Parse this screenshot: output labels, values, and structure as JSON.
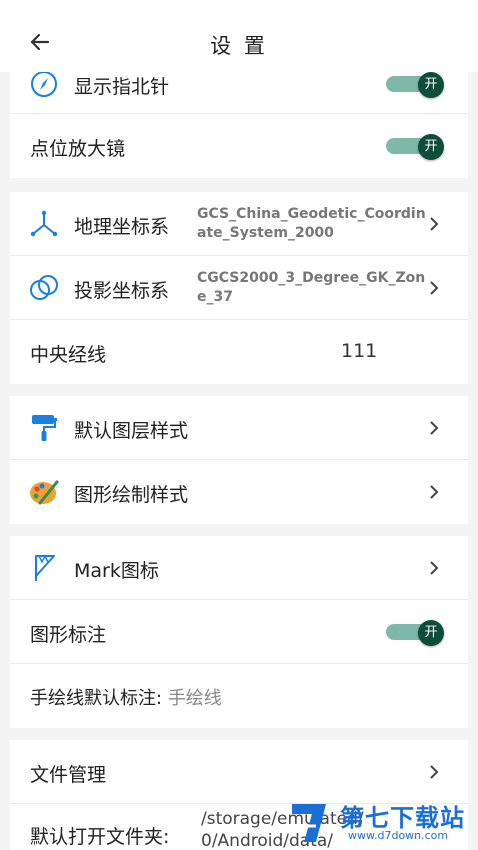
{
  "header": {
    "title": "设 置"
  },
  "rows": {
    "compass": {
      "label": "显示指北针",
      "toggle": "开"
    },
    "magnifier": {
      "label": "点位放大镜",
      "toggle": "开"
    },
    "geo_crs": {
      "label": "地理坐标系",
      "value": "GCS_China_Geodetic_Coordinate_System_2000"
    },
    "proj_crs": {
      "label": "投影坐标系",
      "value": "CGCS2000_3_Degree_GK_Zone_37"
    },
    "meridian": {
      "label": "中央经线",
      "value": "111"
    },
    "layer_style": {
      "label": "默认图层样式"
    },
    "draw_style": {
      "label": "图形绘制样式"
    },
    "mark_icon": {
      "label": "Mark图标"
    },
    "shape_label": {
      "label": "图形标注",
      "toggle": "开"
    },
    "freehand_label": {
      "label": "手绘线默认标注:",
      "value": "手绘线"
    },
    "file_mgmt": {
      "label": "文件管理"
    },
    "default_folder": {
      "label": "默认打开文件夹:",
      "value_line1": "/storage/emulated/",
      "value_line2": "0/Android/data/"
    }
  },
  "watermark": {
    "title": "第七下载站",
    "url": "www.d7down.com"
  },
  "colors": {
    "toggle_track": "#7db8a9",
    "toggle_knob": "#0d4d3a",
    "icon_blue": "#1a7fe0"
  }
}
